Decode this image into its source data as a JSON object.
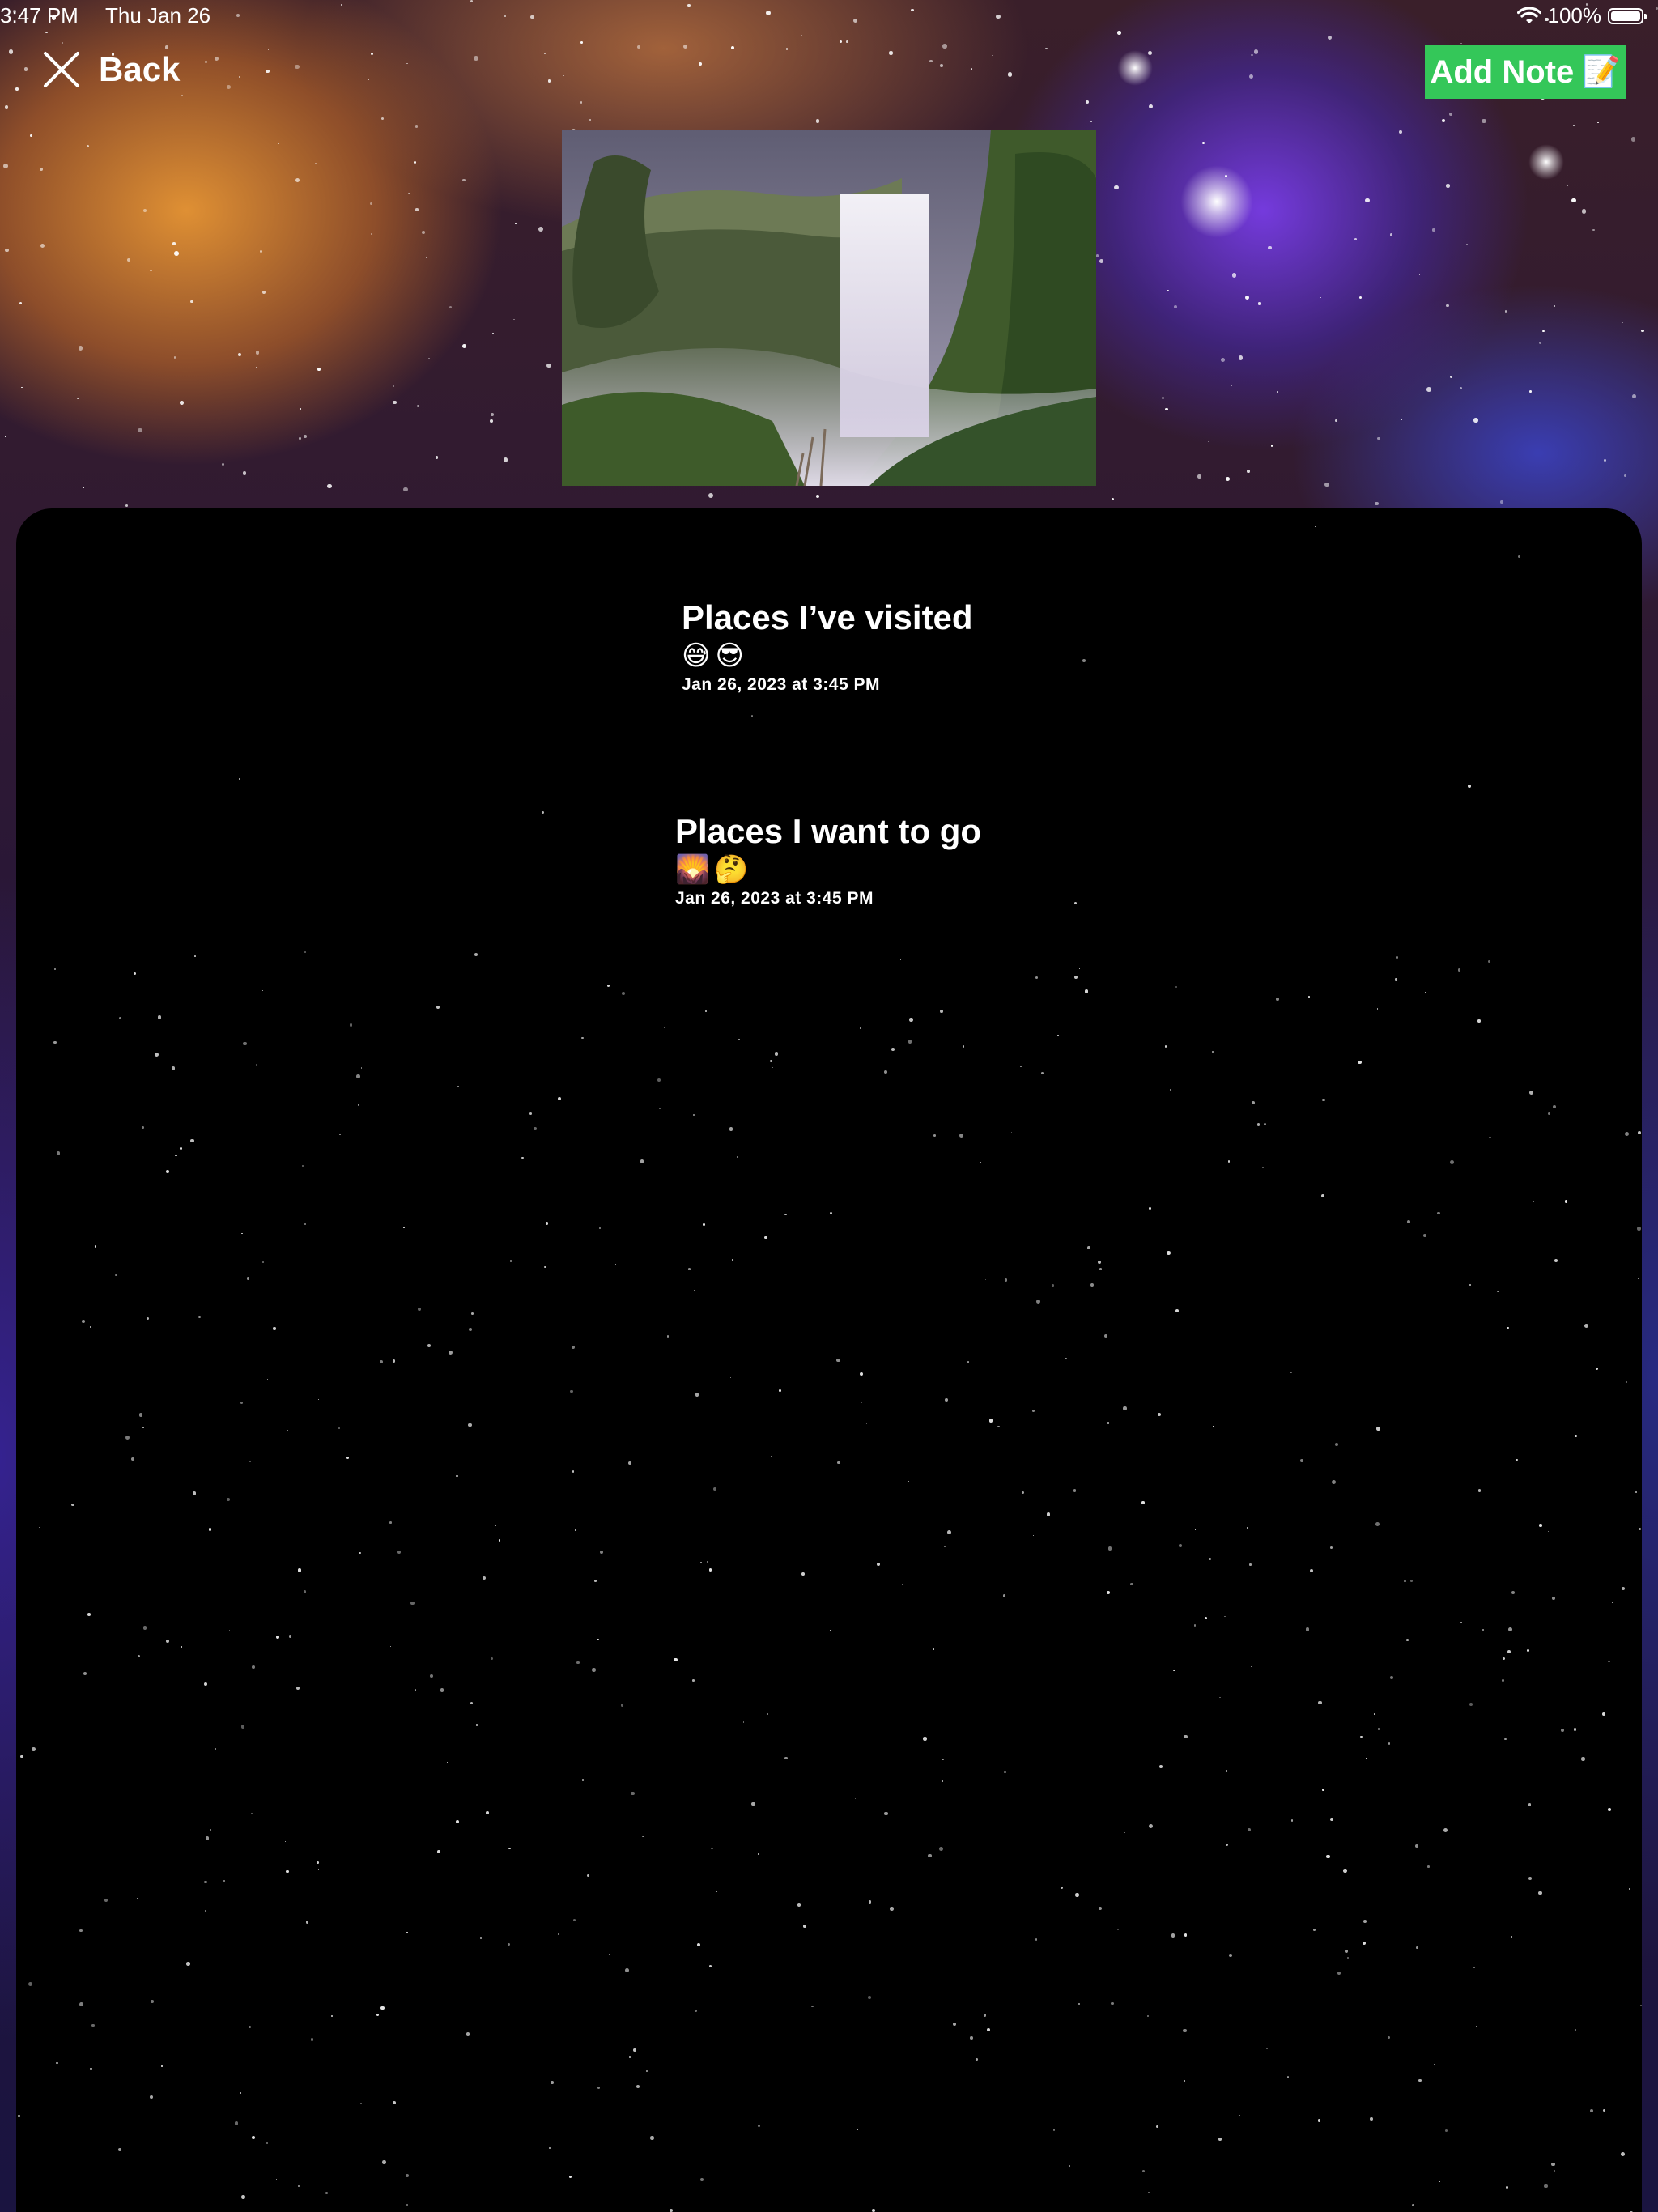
{
  "status_bar": {
    "time": "3:47 PM",
    "date": "Thu Jan 26",
    "battery_text": "100%",
    "battery_level": 1.0
  },
  "nav": {
    "back_label": "Back",
    "back_icon": "close-x-icon",
    "add_note_label": "Add Note",
    "add_note_emoji": "📝",
    "add_note_color": "#34c759"
  },
  "hero": {
    "subject": "waterfall landscape photo"
  },
  "notes": [
    {
      "title": "Places I’ve visited",
      "emojis": [
        "😅",
        "😎"
      ],
      "date": "Jan 26, 2023 at 3:45 PM"
    },
    {
      "title": "Places I want to go",
      "emojis": [
        "🌄",
        "🤔"
      ],
      "date": "Jan 26, 2023 at 3:45 PM"
    }
  ],
  "colors": {
    "panel_background": "#000000",
    "accent_green": "#34c759",
    "text": "#ffffff"
  }
}
